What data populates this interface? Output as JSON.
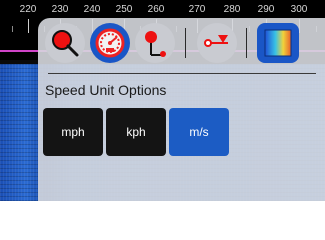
{
  "axis": {
    "labels": [
      "220",
      "230",
      "240",
      "250",
      "260",
      "270",
      "280",
      "290",
      "300"
    ]
  },
  "toolbar": {
    "buttons": [
      {
        "icon": "magnifier-icon",
        "active": false
      },
      {
        "icon": "speedometer-icon",
        "active": true
      },
      {
        "icon": "pin-icon",
        "active": false
      },
      {
        "icon": "filter-funnel-icon",
        "active": false
      },
      {
        "icon": "spectrogram-icon",
        "active": true
      }
    ]
  },
  "speed_units": {
    "title": "Speed Unit Options",
    "options": [
      "mph",
      "kph",
      "m/s"
    ],
    "selected": "m/s"
  },
  "colors": {
    "accent": "#1c5cc4",
    "marker_line": "#d044c8",
    "button_dark": "#141414"
  }
}
